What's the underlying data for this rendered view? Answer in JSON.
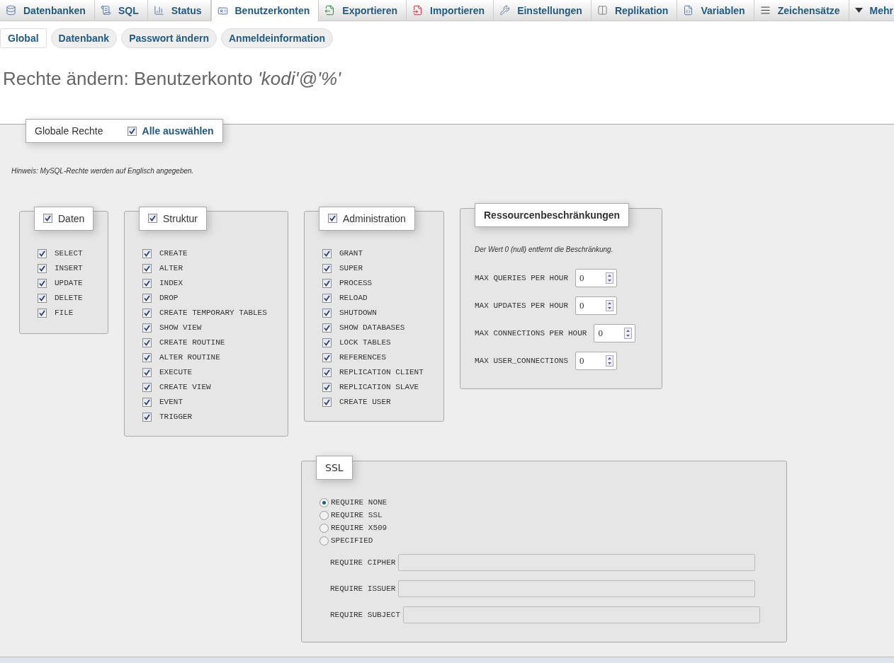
{
  "top_tabs": [
    {
      "label": "Datenbanken",
      "selected": false
    },
    {
      "label": "SQL",
      "selected": false
    },
    {
      "label": "Status",
      "selected": false
    },
    {
      "label": "Benutzerkonten",
      "selected": true
    },
    {
      "label": "Exportieren",
      "selected": false
    },
    {
      "label": "Importieren",
      "selected": false
    },
    {
      "label": "Einstellungen",
      "selected": false
    },
    {
      "label": "Replikation",
      "selected": false
    },
    {
      "label": "Variablen",
      "selected": false
    },
    {
      "label": "Zeichensätze",
      "selected": false
    },
    {
      "label": "Mehr",
      "selected": false
    }
  ],
  "sub_tabs": [
    {
      "label": "Global",
      "selected": true
    },
    {
      "label": "Datenbank",
      "selected": false
    },
    {
      "label": "Passwort ändern",
      "selected": false
    },
    {
      "label": "Anmeldeinformation",
      "selected": false
    }
  ],
  "title": "Rechte ändern: Benutzerkonto *'kodi'@'%'*",
  "global_privileges": {
    "legend": "Globale Rechte",
    "select_all": {
      "label": "Alle auswählen",
      "checked": true
    },
    "note": "Hinweis: MySQL-Rechte werden auf Englisch angegeben.",
    "groups": [
      {
        "label": "Daten",
        "checked": true,
        "privileges": [
          {
            "label": "SELECT",
            "checked": true
          },
          {
            "label": "INSERT",
            "checked": true
          },
          {
            "label": "UPDATE",
            "checked": true
          },
          {
            "label": "DELETE",
            "checked": true
          },
          {
            "label": "FILE",
            "checked": true
          }
        ]
      },
      {
        "label": "Struktur",
        "checked": true,
        "privileges": [
          {
            "label": "CREATE",
            "checked": true
          },
          {
            "label": "ALTER",
            "checked": true
          },
          {
            "label": "INDEX",
            "checked": true
          },
          {
            "label": "DROP",
            "checked": true
          },
          {
            "label": "CREATE TEMPORARY TABLES",
            "checked": true
          },
          {
            "label": "SHOW VIEW",
            "checked": true
          },
          {
            "label": "CREATE ROUTINE",
            "checked": true
          },
          {
            "label": "ALTER ROUTINE",
            "checked": true
          },
          {
            "label": "EXECUTE",
            "checked": true
          },
          {
            "label": "CREATE VIEW",
            "checked": true
          },
          {
            "label": "EVENT",
            "checked": true
          },
          {
            "label": "TRIGGER",
            "checked": true
          }
        ]
      },
      {
        "label": "Administration",
        "checked": true,
        "privileges": [
          {
            "label": "GRANT",
            "checked": true
          },
          {
            "label": "SUPER",
            "checked": true
          },
          {
            "label": "PROCESS",
            "checked": true
          },
          {
            "label": "RELOAD",
            "checked": true
          },
          {
            "label": "SHUTDOWN",
            "checked": true
          },
          {
            "label": "SHOW DATABASES",
            "checked": true
          },
          {
            "label": "LOCK TABLES",
            "checked": true
          },
          {
            "label": "REFERENCES",
            "checked": true
          },
          {
            "label": "REPLICATION CLIENT",
            "checked": true
          },
          {
            "label": "REPLICATION SLAVE",
            "checked": true
          },
          {
            "label": "CREATE USER",
            "checked": true
          }
        ]
      }
    ]
  },
  "resource_limits": {
    "legend": "Ressourcenbeschränkungen",
    "note": "Der Wert 0 (null) entfernt die Beschränkung.",
    "limits": [
      {
        "label": "MAX QUERIES PER HOUR",
        "value": "0"
      },
      {
        "label": "MAX UPDATES PER HOUR",
        "value": "0"
      },
      {
        "label": "MAX CONNECTIONS PER HOUR",
        "value": "0"
      },
      {
        "label": "MAX USER_CONNECTIONS",
        "value": "0"
      }
    ]
  },
  "ssl": {
    "legend": "SSL",
    "options": [
      {
        "label": "REQUIRE NONE",
        "selected": true
      },
      {
        "label": "REQUIRE SSL",
        "selected": false
      },
      {
        "label": "REQUIRE X509",
        "selected": false
      },
      {
        "label": "SPECIFIED",
        "selected": false
      }
    ],
    "fields": [
      {
        "label": "REQUIRE CIPHER"
      },
      {
        "label": "REQUIRE ISSUER"
      },
      {
        "label": "REQUIRE SUBJECT"
      }
    ]
  }
}
